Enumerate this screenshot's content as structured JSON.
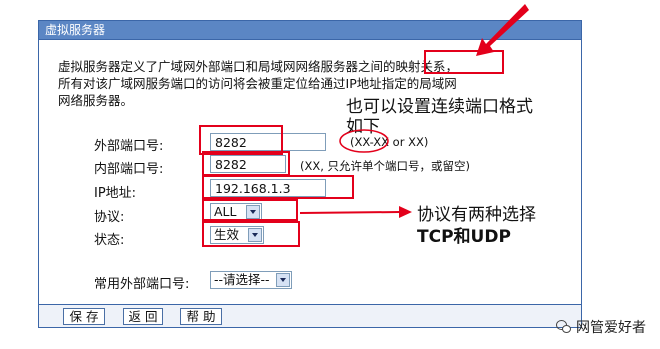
{
  "panel": {
    "title": "虚拟服务器"
  },
  "description": {
    "line1a": "虚拟服务器定义了广域网外部端口和局域网网络服务器之间的",
    "line1b": "映射关系，",
    "line2": "所有对该广域网服务端口的访问将会被重定位给通过IP地址指定的局域网",
    "line3": "网络服务器。"
  },
  "form": {
    "external_port_label": "外部端口号:",
    "external_port_value": "8282",
    "external_port_hint": "(XX-XX or XX)",
    "internal_port_label": "内部端口号:",
    "internal_port_value": "8282",
    "internal_port_hint": "(XX, 只允许单个端口号，或留空)",
    "ip_label": "IP地址:",
    "ip_value": "192.168.1.3",
    "protocol_label": "协议:",
    "protocol_value": "ALL",
    "status_label": "状态:",
    "status_value": "生效",
    "common_port_label": "常用外部端口号:",
    "common_port_value": "--请选择--"
  },
  "buttons": {
    "save": "保 存",
    "back": "返 回",
    "help": "帮 助"
  },
  "annotations": {
    "range_note_line1": "也可以设置连续端口格式",
    "range_note_line2": "如下",
    "protocol_note_line1": "协议有两种选择",
    "protocol_note_line2": "TCP和UDP"
  },
  "watermark": {
    "text": "网管爱好者",
    "icon": "wechat-icon"
  },
  "colors": {
    "title_bar": "#5b86c4",
    "border": "#3b66a8",
    "annotation_red": "#e3001b"
  }
}
